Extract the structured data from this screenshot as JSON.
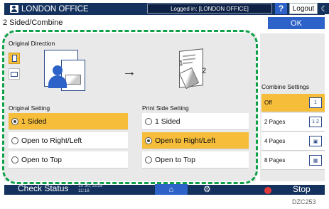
{
  "topbar": {
    "office": "LONDON OFFICE",
    "login_status": "Logged in: [LONDON OFFICE]",
    "help": "?",
    "logout": "Logout"
  },
  "header": {
    "title": "2 Sided/Combine",
    "ok": "OK"
  },
  "original_direction": {
    "title": "Original Direction"
  },
  "original_setting": {
    "title": "Original Setting",
    "options": [
      {
        "label": "1 Sided",
        "selected": true
      },
      {
        "label": "Open to Right/Left",
        "selected": false
      },
      {
        "label": "Open to Top",
        "selected": false
      }
    ]
  },
  "print_side_setting": {
    "title": "Print Side Setting",
    "options": [
      {
        "label": "1 Sided",
        "selected": false
      },
      {
        "label": "Open to Right/Left",
        "selected": true
      },
      {
        "label": "Open to Top",
        "selected": false
      }
    ]
  },
  "preview": {
    "arrow": "→",
    "page1": "1",
    "page2": "2"
  },
  "combine_settings": {
    "title": "Combine Settings",
    "items": [
      {
        "label": "Off",
        "icon_text": "1",
        "selected": true
      },
      {
        "label": "2 Pages",
        "icon_text": "1 2",
        "selected": false
      },
      {
        "label": "4 Pages",
        "icon_text": "",
        "selected": false
      },
      {
        "label": "8 Pages",
        "icon_text": "",
        "selected": false
      }
    ]
  },
  "bottombar": {
    "check_status": "Check Status",
    "date": "10 30, 2019",
    "time": "11:18",
    "stop": "Stop"
  },
  "footer_code": "DZC253",
  "colors": {
    "navy": "#15325f",
    "accent_blue": "#2d63c8",
    "selected_yellow": "#f5bd3a",
    "dashed_green": "#0fa048"
  }
}
